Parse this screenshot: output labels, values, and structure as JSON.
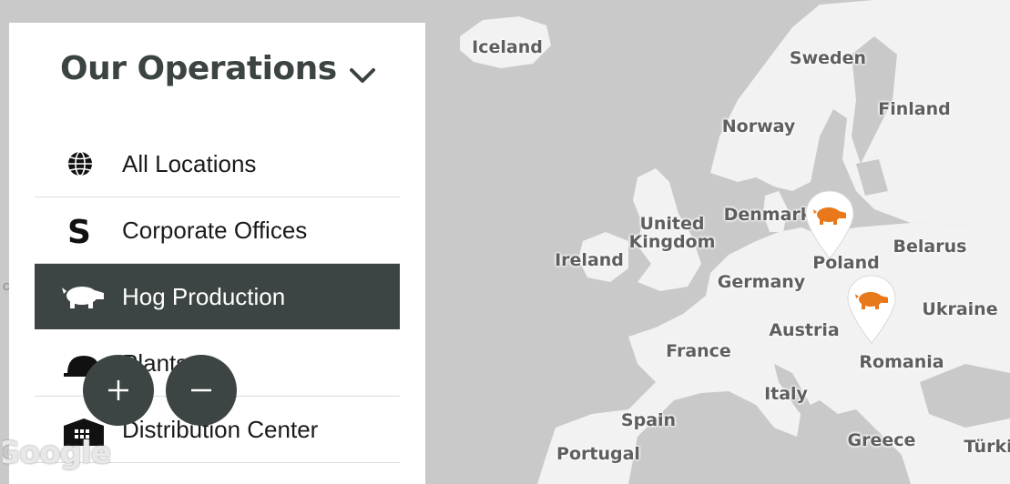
{
  "panel": {
    "title": "Our Operations",
    "items": [
      {
        "label": "All Locations",
        "icon": "globe-icon"
      },
      {
        "label": "Corporate Offices",
        "icon": "smithfield-s-icon"
      },
      {
        "label": "Hog Production",
        "icon": "pig-icon",
        "active": true
      },
      {
        "label": "Plants",
        "icon": "hardhat-icon"
      },
      {
        "label": "Distribution Center",
        "icon": "warehouse-icon"
      }
    ]
  },
  "map": {
    "countries": [
      "Iceland",
      "Sweden",
      "Finland",
      "Norway",
      "United Kingdom",
      "Denmark",
      "Ireland",
      "Belarus",
      "Poland",
      "Germany",
      "Ukraine",
      "Austria",
      "France",
      "Romania",
      "Italy",
      "Spain",
      "Greece",
      "Portugal",
      "Türki"
    ],
    "markers": [
      {
        "name": "hog-marker-poland",
        "icon": "pig-icon"
      },
      {
        "name": "hog-marker-romania",
        "icon": "pig-icon"
      }
    ],
    "attribution": "Google",
    "edge_text": "c"
  },
  "zoom": {
    "in_label": "+",
    "out_label": "−"
  },
  "colors": {
    "panel_bg": "#ffffff",
    "active_bg": "#3c4543",
    "accent": "#e8781a",
    "land": "#f2f2f2",
    "water": "#c9c9c9"
  }
}
